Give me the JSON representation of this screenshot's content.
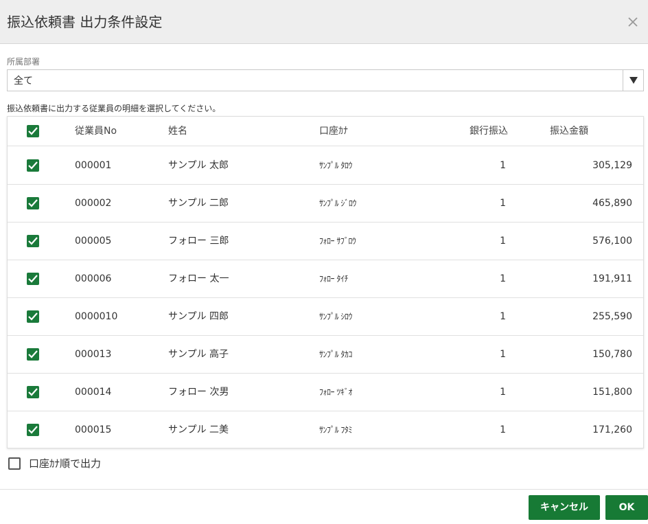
{
  "dialog": {
    "title": "振込依頼書 出力条件設定"
  },
  "department": {
    "label": "所属部署",
    "value": "全て"
  },
  "instruction": "振込依頼書に出力する従業員の明細を選択してください。",
  "table": {
    "headers": {
      "no": "従業員No",
      "name": "姓名",
      "kana": "口座ｶﾅ",
      "bank": "銀行振込",
      "amount": "振込金額"
    },
    "rows": [
      {
        "checked": true,
        "no": "000001",
        "name": "サンプル 太郎",
        "kana": "ｻﾝﾌﾟﾙ ﾀﾛｳ",
        "bank": "1",
        "amount": "305,129"
      },
      {
        "checked": true,
        "no": "000002",
        "name": "サンプル 二郎",
        "kana": "ｻﾝﾌﾟﾙ ｼﾞﾛｳ",
        "bank": "1",
        "amount": "465,890"
      },
      {
        "checked": true,
        "no": "000005",
        "name": "フォロー 三郎",
        "kana": "ﾌｫﾛｰ ｻﾌﾞﾛｳ",
        "bank": "1",
        "amount": "576,100"
      },
      {
        "checked": true,
        "no": "000006",
        "name": "フォロー 太一",
        "kana": "ﾌｫﾛｰ ﾀｲﾁ",
        "bank": "1",
        "amount": "191,911"
      },
      {
        "checked": true,
        "no": "0000010",
        "name": "サンプル 四郎",
        "kana": "ｻﾝﾌﾟﾙ ｼﾛｳ",
        "bank": "1",
        "amount": "255,590"
      },
      {
        "checked": true,
        "no": "000013",
        "name": "サンプル 高子",
        "kana": "ｻﾝﾌﾟﾙ ﾀｶｺ",
        "bank": "1",
        "amount": "150,780"
      },
      {
        "checked": true,
        "no": "000014",
        "name": "フォロー 次男",
        "kana": "ﾌｫﾛｰ ﾂｷﾞｵ",
        "bank": "1",
        "amount": "151,800"
      },
      {
        "checked": true,
        "no": "000015",
        "name": "サンプル 二美",
        "kana": "ｻﾝﾌﾟﾙ ﾌﾀﾐ",
        "bank": "1",
        "amount": "171,260"
      }
    ]
  },
  "order_option": {
    "label": "口座ｶﾅ順で出力",
    "checked": false
  },
  "buttons": {
    "cancel": "キャンセル",
    "ok": "OK"
  },
  "colors": {
    "accent": "#177a35",
    "header_bg": "#eeeeee"
  },
  "icons": {
    "close": "close-icon",
    "dropdown": "triangle-down-icon",
    "check": "check-icon"
  }
}
